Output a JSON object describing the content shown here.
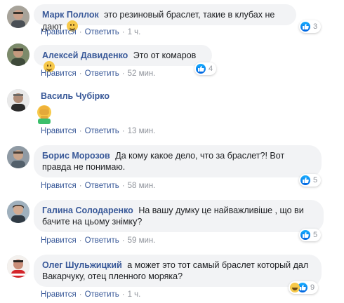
{
  "actions": {
    "like": "Нравится",
    "reply": "Ответить",
    "sep": "·"
  },
  "comments": [
    {
      "author": "Марк Поллок",
      "text": "это резиновый браслет, такие в клубах не дают",
      "time": "1 ч.",
      "reactions": "3"
    },
    {
      "author": "Алексей Давиденко",
      "text": "Это от комаров",
      "time": "52 мин.",
      "reactions": "4"
    },
    {
      "author": "Василь Чубірко",
      "text": "",
      "time": "13 мин.",
      "reactions": ""
    },
    {
      "author": "Борис Морозов",
      "text": "Да кому какое дело, что за браслет?! Вот правда не понимаю.",
      "time": "58 мин.",
      "reactions": "5"
    },
    {
      "author": "Галина Солодаренко",
      "text": "На вашу думку це найважливіше , що ви бачите на цьому знімку?",
      "time": "59 мин.",
      "reactions": "5"
    },
    {
      "author": "Олег Шульжицкий",
      "text": "а может это тот самый браслет который дал Вакарчуку, отец пленного моряка?",
      "time": "1 ч.",
      "reactions": "9"
    }
  ],
  "colors": {
    "name": "#385898",
    "bubble": "#f2f3f5",
    "like": "#1877f2",
    "meta": "#90949c"
  }
}
